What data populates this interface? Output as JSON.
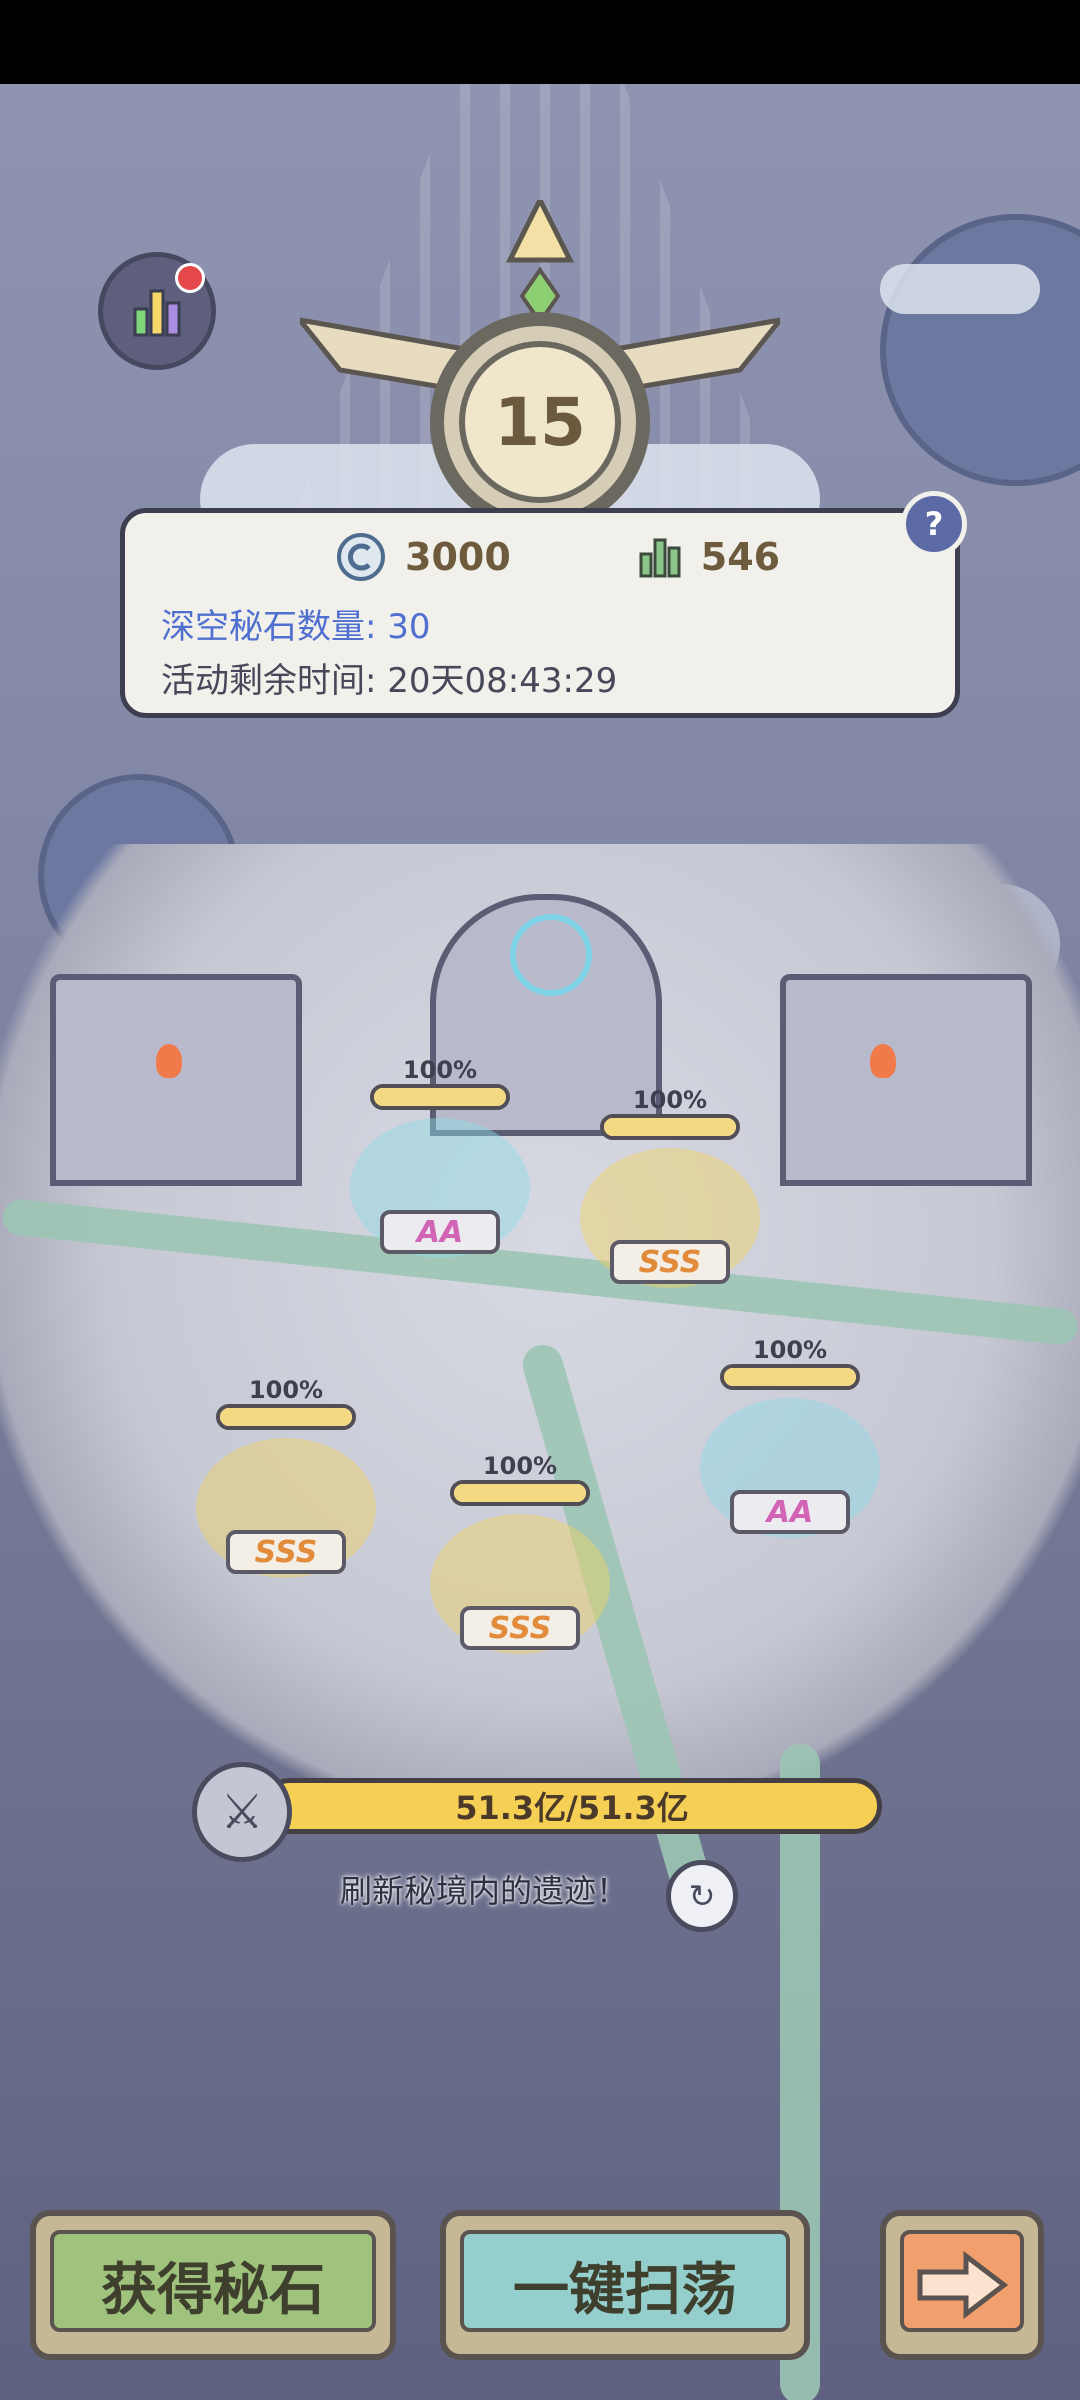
{
  "level": "15",
  "info": {
    "coins": "3000",
    "score": "546",
    "stone_count_text": "深空秘石数量: 30",
    "time_left_text": "活动剩余时间: 20天08:43:29"
  },
  "sites": [
    {
      "progress_text": "100%",
      "grade": "AA"
    },
    {
      "progress_text": "100%",
      "grade": "SSS"
    },
    {
      "progress_text": "100%",
      "grade": "AA"
    },
    {
      "progress_text": "100%",
      "grade": "SSS"
    },
    {
      "progress_text": "100%",
      "grade": "SSS"
    }
  ],
  "power": {
    "text": "51.3亿/51.3亿"
  },
  "refresh_text": "刷新秘境内的遗迹！",
  "buttons": {
    "get": "获得秘石",
    "sweep": "一键扫荡"
  },
  "icons": {
    "coin": "coin-icon",
    "score": "bars-icon",
    "stats": "stats-icon",
    "help": "question-icon",
    "swords": "crossed-swords-icon",
    "refresh": "refresh-icon",
    "next": "arrow-right-icon"
  }
}
